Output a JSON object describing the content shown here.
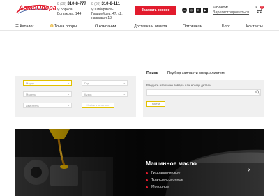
{
  "header": {
    "logo_text": "АвтоОпора",
    "phone1": {
      "code": "8 (36)",
      "number": "310-8-777",
      "address": "Бориса Богаткова, 144"
    },
    "phone2": {
      "code": "8 (36)",
      "number": "310-8-111",
      "address": "Сибиряков-Гвардейцев, 47, к2, павильон 13"
    },
    "callback_label": "Заказать звонок",
    "socials": [
      "vk-icon",
      "instagram-icon",
      "mail-icon",
      "youtube-icon"
    ],
    "login_label": "Войти/",
    "register_label": "Зарегистрироваться",
    "cart_count": "0"
  },
  "nav": {
    "items": [
      "Каталог",
      "Точка опоры",
      "О компании",
      "Доставка и оплата",
      "Оптовикам",
      "Блог",
      "Контакты"
    ]
  },
  "search_left": {
    "fields": [
      "Марку",
      "Год",
      "Модель",
      "Кузов",
      "Двигатель"
    ],
    "button_label": "Найти в каталоге"
  },
  "search_right": {
    "tabs": [
      "Поиск",
      "Подбор запчасти специалистом"
    ],
    "label": "Введите название товара или номер детали",
    "button_label": "Найти"
  },
  "banner": {
    "title": "Машинное масло",
    "bullets": [
      "Гидравлическое",
      "Трансмиссионное",
      "Моторное"
    ]
  },
  "colors": {
    "accent": "#e21b2d",
    "highlight": "#e2c100"
  }
}
